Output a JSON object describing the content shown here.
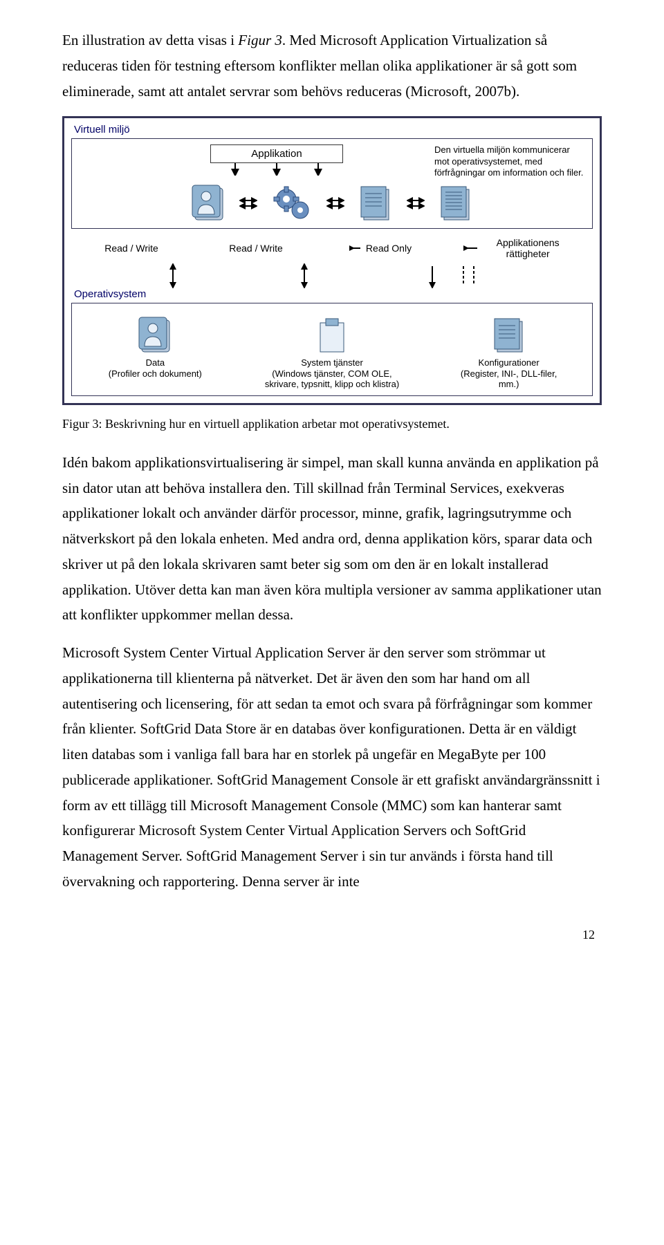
{
  "para1_a": "En illustration av detta visas i ",
  "para1_b": "Figur 3",
  "para1_c": ". Med Microsoft Application Virtualization så reduceras tiden för testning eftersom konflikter mellan olika applikationer är så gott som eliminerade, samt att antalet servrar som behövs reduceras (Microsoft, 2007b).",
  "figure": {
    "virtuell_label": "Virtuell miljö",
    "applikation": "Applikation",
    "desc": "Den virtuella miljön kommunicerar mot operativsystemet, med förfrågningar om information och filer.",
    "mid1": "Read / Write",
    "mid2": "Read / Write",
    "mid3": "Read Only",
    "mid4": "Applikationens rättigheter",
    "os_label": "Operativsystem",
    "os1_title": "Data",
    "os1_sub": "(Profiler och dokument)",
    "os2_title": "System tjänster",
    "os2_sub": "(Windows tjänster, COM OLE, skrivare, typsnitt, klipp och klistra)",
    "os3_title": "Konfigurationer",
    "os3_sub": "(Register, INI-, DLL-filer, mm.)"
  },
  "caption": "Figur 3: Beskrivning hur en virtuell applikation arbetar mot operativsystemet.",
  "para2": "Idén bakom applikationsvirtualisering är simpel, man skall kunna använda en applikation på sin dator utan att behöva installera den. Till skillnad från Terminal Services, exekveras applikationer lokalt och använder därför processor, minne, grafik, lagringsutrymme och nätverkskort på den lokala enheten. Med andra ord, denna applikation körs, sparar data och skriver ut på den lokala skrivaren samt beter sig som om den är en lokalt installerad applikation. Utöver detta kan man även köra multipla versioner av samma applikationer utan att konflikter uppkommer mellan dessa.",
  "para3": "Microsoft System Center Virtual Application Server är den server som strömmar ut applikationerna till klienterna på nätverket. Det är även den som har hand om all autentisering och licensering, för att sedan ta emot och svara på förfrågningar som kommer från klienter. SoftGrid Data Store är en databas över konfigurationen. Detta är en väldigt liten databas som i vanliga fall bara har en storlek på ungefär en MegaByte per 100 publicerade applikationer. SoftGrid Management Console är ett grafiskt användargränssnitt i form av ett tillägg till Microsoft Management Console (MMC) som kan hanterar samt konfigurerar Microsoft System Center Virtual Application Servers och SoftGrid Management Server. SoftGrid Management Server i sin tur används i första hand till övervakning och rapportering. Denna server är inte",
  "page_number": "12"
}
